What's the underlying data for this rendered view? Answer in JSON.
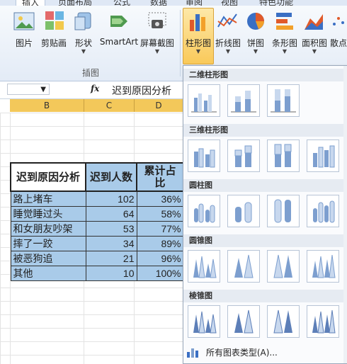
{
  "tabs": [
    "插入",
    "页面布局",
    "公式",
    "数据",
    "审阅",
    "视图",
    "特色功能"
  ],
  "ribbon": {
    "buttons": [
      "图片",
      "剪贴画",
      "形状",
      "SmartArt",
      "屏幕截图",
      "柱形图",
      "折线图",
      "饼图",
      "条形图",
      "面积图",
      "散点"
    ],
    "group_label": "插图"
  },
  "formula_bar": {
    "fx": "fx",
    "value": "迟到原因分析"
  },
  "columns": [
    "B",
    "C",
    "D"
  ],
  "table": {
    "headers": [
      "迟到原因分析",
      "迟到人数",
      "累计占比"
    ],
    "rows": [
      [
        "路上堵车",
        "102",
        "36%"
      ],
      [
        "睡觉睡过头",
        "64",
        "58%"
      ],
      [
        "和女朋友吵架",
        "53",
        "77%"
      ],
      [
        "摔了一跤",
        "34",
        "89%"
      ],
      [
        "被恶狗追",
        "21",
        "96%"
      ],
      [
        "其他",
        "10",
        "100%"
      ]
    ]
  },
  "dropdown": {
    "sections": [
      "二维柱形图",
      "三维柱形图",
      "圆柱图",
      "圆锥图",
      "棱锥图"
    ],
    "all_types": "所有图表类型(A)..."
  },
  "colors": {
    "accent": "#f9c95a",
    "cell_fill": "#a9cbe9",
    "header_col": "#f3c85a"
  }
}
